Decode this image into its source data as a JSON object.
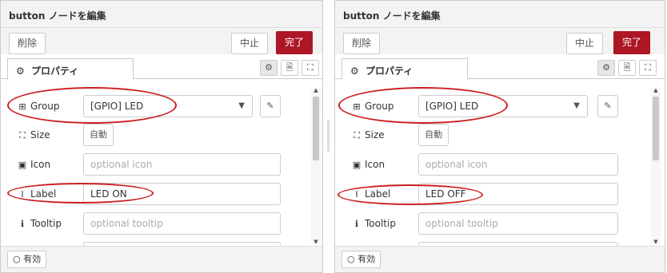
{
  "panels": [
    {
      "title": "button ノードを編集",
      "delete_label": "削除",
      "cancel_label": "中止",
      "done_label": "完了",
      "tab_label": "プロパティ",
      "group_label": "Group",
      "group_value": "[GPIO] LED",
      "size_label": "Size",
      "size_value": "自動",
      "icon_label": "Icon",
      "icon_placeholder": "optional icon",
      "label_label": "Label",
      "label_value": "LED ON",
      "tooltip_label": "Tooltip",
      "tooltip_placeholder": "optional tooltip",
      "enabled_label": "有効"
    },
    {
      "title": "button ノードを編集",
      "delete_label": "削除",
      "cancel_label": "中止",
      "done_label": "完了",
      "tab_label": "プロパティ",
      "group_label": "Group",
      "group_value": "[GPIO] LED",
      "size_label": "Size",
      "size_value": "自動",
      "icon_label": "Icon",
      "icon_placeholder": "optional icon",
      "label_label": "Label",
      "label_value": "LED OFF",
      "tooltip_label": "Tooltip",
      "tooltip_placeholder": "optional tooltip",
      "enabled_label": "有効"
    }
  ],
  "icons": {
    "gear": "⚙",
    "table": "⊞",
    "resize": "⛶",
    "image": "▣",
    "text_cursor": "I",
    "info": "ℹ",
    "pencil": "✎",
    "doc": "🗎",
    "chevron": "⌄"
  },
  "colors": {
    "primary": "#ad1625",
    "annotation": "#cc1f1f"
  }
}
